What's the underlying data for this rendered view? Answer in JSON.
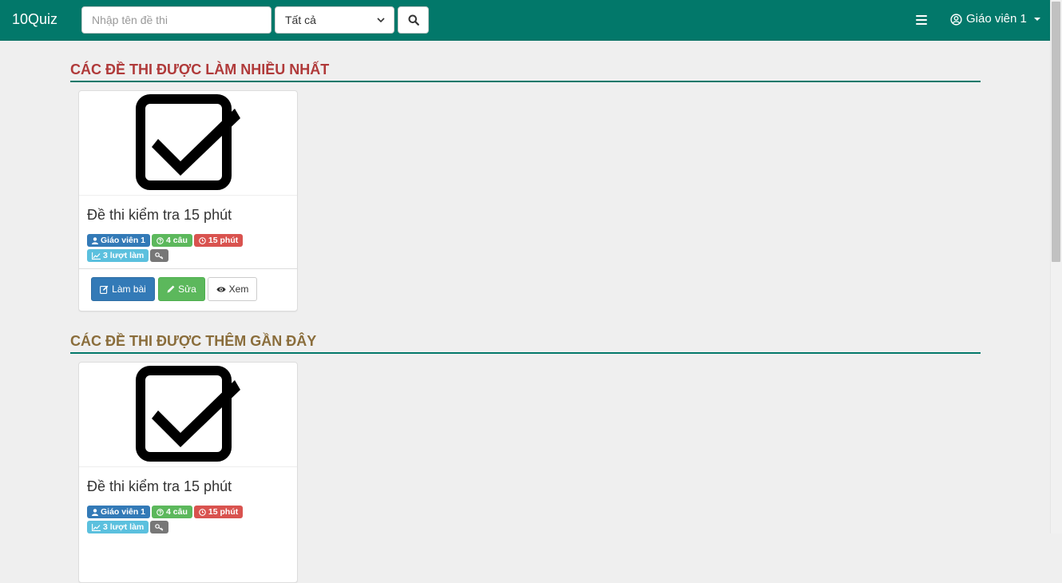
{
  "navbar": {
    "brand": "10Quiz",
    "search_placeholder": "Nhập tên đề thi",
    "category_selected": "Tất cả",
    "user_name": "Giáo viên 1"
  },
  "sections": [
    {
      "title": "Các đề thi được làm nhiều nhất",
      "card": {
        "title": "Đề thi kiểm tra 15 phút",
        "author": "Giáo viên 1",
        "questions": "4 câu",
        "duration": "15 phút",
        "attempts": "3 lượt làm",
        "buttons": {
          "take": "Làm bài",
          "edit": "Sửa",
          "view": "Xem"
        }
      }
    },
    {
      "title": "Các đề thi được thêm gần đây",
      "card": {
        "title": "Đề thi kiểm tra 15 phút",
        "author": "Giáo viên 1",
        "questions": "4 câu",
        "duration": "15 phút",
        "attempts": "3 lượt làm"
      }
    }
  ],
  "colors": {
    "navbar": "#02786a",
    "section_top_title": "#b03a3a",
    "section_recent_title": "#8a6d3b",
    "badge_author": "#337ab7",
    "badge_questions": "#5cb85c",
    "badge_duration": "#d9534f",
    "badge_attempts": "#5bc0de",
    "badge_key": "#777777"
  },
  "icons": {
    "search": "search-icon",
    "menu": "hamburger-icon",
    "user": "user-circle-icon",
    "quiz_thumbnail": "checkbox-check-icon",
    "author": "user-icon",
    "questions": "question-circle-icon",
    "duration": "clock-icon",
    "attempts": "line-chart-icon",
    "key": "key-icon",
    "take": "edit-icon",
    "edit": "pencil-icon",
    "view": "eye-icon"
  }
}
